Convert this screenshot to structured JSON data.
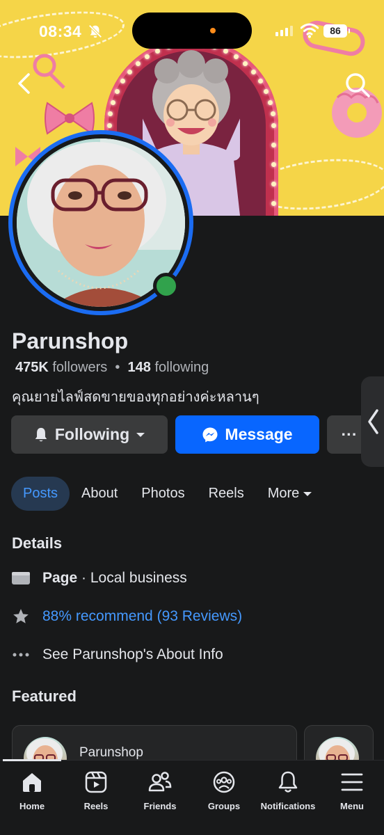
{
  "status_bar": {
    "time": "08:34",
    "battery": "86"
  },
  "profile": {
    "name": "Parunshop",
    "followers_count": "475K",
    "followers_label": "followers",
    "following_count": "148",
    "following_label": "following",
    "bio": "คุณยายไลฟ์สดขายของทุกอย่างค่ะหลานๆ"
  },
  "actions": {
    "following_label": "Following",
    "message_label": "Message",
    "more_label": "···"
  },
  "tabs": [
    {
      "label": "Posts",
      "active": true
    },
    {
      "label": "About"
    },
    {
      "label": "Photos"
    },
    {
      "label": "Reels"
    },
    {
      "label": "More"
    }
  ],
  "details": {
    "heading": "Details",
    "page_label": "Page",
    "category": " · Local business",
    "recommend": "88% recommend (93 Reviews)",
    "about_info": "See Parunshop's About Info"
  },
  "featured": {
    "heading": "Featured",
    "card_name": "Parunshop"
  },
  "bottom_nav": [
    {
      "label": "Home",
      "icon": "home-icon",
      "active": true
    },
    {
      "label": "Reels",
      "icon": "reels-icon"
    },
    {
      "label": "Friends",
      "icon": "friends-icon"
    },
    {
      "label": "Groups",
      "icon": "groups-icon"
    },
    {
      "label": "Notifications",
      "icon": "bell-icon"
    },
    {
      "label": "Menu",
      "icon": "menu-icon"
    }
  ],
  "colors": {
    "background": "#18191a",
    "accent": "#0866ff",
    "link": "#4599ff",
    "online": "#31a24c",
    "cover": "#f5d548"
  }
}
